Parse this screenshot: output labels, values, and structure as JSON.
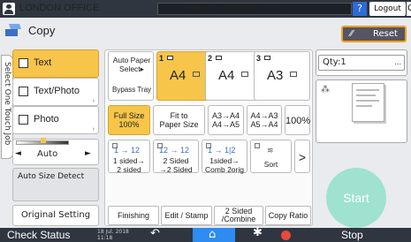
{
  "topbar": {
    "office": "LONDON OFFICE",
    "login": "Logged in: [LONDON OFFICE]",
    "help": "?",
    "logout": "Logout",
    "more": "C"
  },
  "header": {
    "title": "Copy",
    "reset": "Reset"
  },
  "side_tab": "Select One Touch Job",
  "left": {
    "modes": [
      {
        "label": "Text",
        "active": true,
        "icon": "text-mode-icon"
      },
      {
        "label": "Text/Photo",
        "active": false,
        "icon": "text-photo-mode-icon"
      },
      {
        "label": "Photo",
        "active": false,
        "icon": "photo-mode-icon"
      }
    ],
    "density": {
      "label": "Auto",
      "left": "◄",
      "right": "►"
    },
    "auto_size_detect": "Auto Size Detect",
    "original_setting": "Original Setting"
  },
  "paper": {
    "auto": "Auto Paper Select▸",
    "bypass": "Bypass Tray",
    "trays": [
      {
        "num": "1",
        "size": "A4",
        "active": true
      },
      {
        "num": "2",
        "size": "A4",
        "active": false
      },
      {
        "num": "3",
        "size": "A3",
        "active": false
      }
    ]
  },
  "ratio": {
    "tiles": [
      {
        "l1": "Full Size",
        "l2": "100%",
        "active": true
      },
      {
        "l1": "Fit to",
        "l2": "Paper Size",
        "active": false
      },
      {
        "l1": "A3→A4",
        "l2": "A4→A5",
        "active": false
      },
      {
        "l1": "A4→A3",
        "l2": "A5→A4",
        "active": false
      }
    ],
    "value": "100%"
  },
  "duplex": {
    "tiles": [
      {
        "l1": "1 sided→",
        "l2": "2 sided",
        "icons": "1 → 12"
      },
      {
        "l1": "2 Sided",
        "l2": "→2 Sided",
        "icons": "12 → 12"
      },
      {
        "l1": "1sided→",
        "l2": "Comb 2orig",
        "icons": "1 → 1|2"
      },
      {
        "l1": "Sort",
        "l2": "",
        "icons": ""
      }
    ],
    "next": ">"
  },
  "bottom_tabs": [
    "Finishing",
    "Edit / Stamp",
    "2 Sided /Combine",
    "Copy Ratio"
  ],
  "right": {
    "qty_label": "Qty:",
    "qty_value": "1",
    "qty_more": "...",
    "start": "Start"
  },
  "bottombar": {
    "check_status": "Check Status",
    "date": "18 Jul. 2018",
    "time": "11:18",
    "stop": "Stop"
  }
}
